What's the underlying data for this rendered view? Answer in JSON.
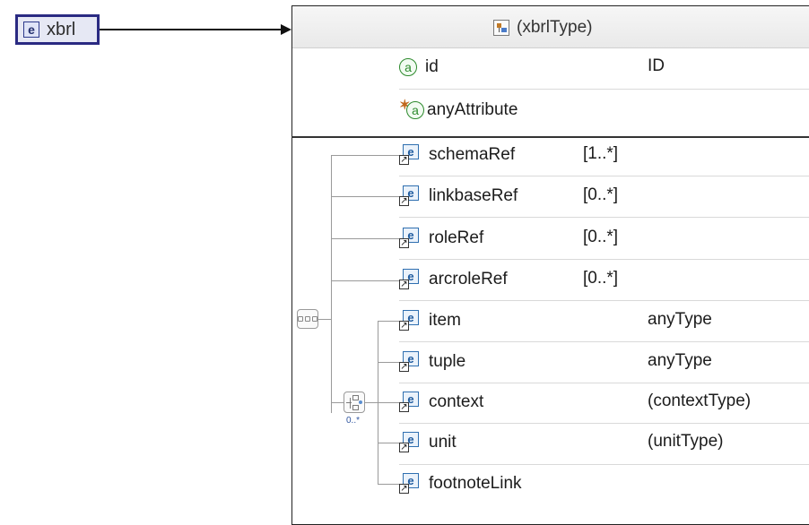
{
  "root_element": {
    "badge": "e",
    "name": "xbrl"
  },
  "type_header": {
    "title": "(xbrlType)"
  },
  "attributes": [
    {
      "name": "id",
      "type": "ID",
      "icon": "attribute-icon",
      "glyph": "a"
    },
    {
      "name": "anyAttribute",
      "type": "",
      "icon": "any-attribute-icon",
      "glyph": "a"
    }
  ],
  "sequence": {
    "icon": "sequence-compositor-icon",
    "elements": [
      {
        "name": "schemaRef",
        "occurrence": "[1..*]"
      },
      {
        "name": "linkbaseRef",
        "occurrence": "[0..*]"
      },
      {
        "name": "roleRef",
        "occurrence": "[0..*]"
      },
      {
        "name": "arcroleRef",
        "occurrence": "[0..*]"
      }
    ]
  },
  "choice": {
    "icon": "choice-compositor-icon",
    "occurrence": "0..*",
    "elements": [
      {
        "name": "item",
        "type": "anyType"
      },
      {
        "name": "tuple",
        "type": "anyType"
      },
      {
        "name": "context",
        "type": "(contextType)"
      },
      {
        "name": "unit",
        "type": "(unitType)"
      },
      {
        "name": "footnoteLink",
        "type": ""
      }
    ]
  },
  "icon_glyphs": {
    "element_ref": "e",
    "ref_arrow": "↗"
  },
  "colors": {
    "root_border": "#2a2a82",
    "attribute": "#2d8a2d",
    "element_ref": "#2f6fb0",
    "occurrence_label": "#2f55a0"
  }
}
